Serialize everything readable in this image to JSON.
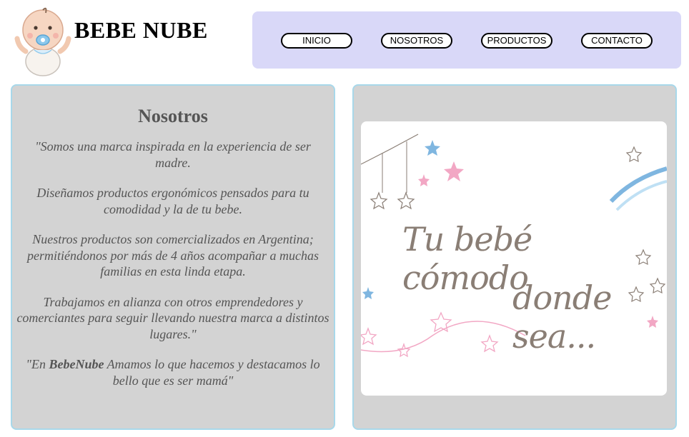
{
  "header": {
    "brand": "BEBE NUBE"
  },
  "nav": {
    "items": [
      {
        "label": "INICIO"
      },
      {
        "label": "NOSOTROS"
      },
      {
        "label": "PRODUCTOS"
      },
      {
        "label": "CONTACTO"
      }
    ]
  },
  "about": {
    "title": "Nosotros",
    "paragraphs": [
      "\"Somos una marca inspirada en la experiencia de ser madre.",
      "Diseñamos productos ergonómicos pensados para tu comodidad y la de tu bebe.",
      "Nuestros productos son comercializados en Argentina; permitiéndonos por más de 4 años acompañar a muchas familias en esta linda etapa.",
      "Trabajamos en alianza con otros emprendedores y comerciantes para seguir llevando nuestra marca a distintos lugares.\""
    ],
    "closing_prefix": "\"En ",
    "closing_brand": "BebeNube",
    "closing_suffix": " Amamos lo que hacemos y destacamos lo bello que es ser mamá\""
  },
  "banner": {
    "line1": "Tu bebé cómodo",
    "line2": "donde sea..."
  },
  "colors": {
    "nav_bg": "#d9d8f8",
    "panel_bg": "#d3d3d3",
    "panel_border": "#a8d8ea",
    "text": "#555555"
  },
  "icons": {
    "logo": "baby-with-pacifier-icon"
  }
}
